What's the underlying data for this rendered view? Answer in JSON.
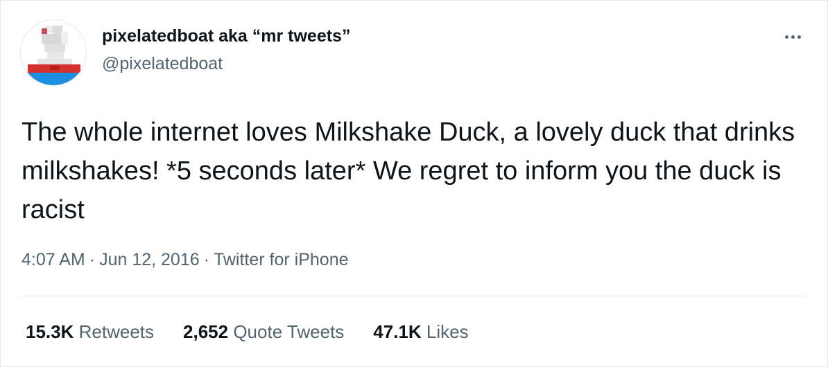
{
  "user": {
    "display_name": "pixelatedboat aka “mr tweets”",
    "handle": "@pixelatedboat"
  },
  "more_icon": "more-horizontal-icon",
  "tweet_text": "The whole internet loves Milkshake Duck, a lovely duck that drinks milkshakes! *5 seconds later* We regret to inform you the duck is racist",
  "meta": {
    "time": "4:07 AM",
    "separator": "·",
    "date": "Jun 12, 2016",
    "source": "Twitter for iPhone"
  },
  "stats": {
    "retweets_count": "15.3K",
    "retweets_label": "Retweets",
    "quotes_count": "2,652",
    "quotes_label": "Quote Tweets",
    "likes_count": "47.1K",
    "likes_label": "Likes"
  },
  "colors": {
    "text_primary": "#0f1419",
    "text_secondary": "#536471",
    "divider": "#e6e6e6",
    "avatar_red": "#d32f2f",
    "avatar_blue": "#1e8fe0"
  }
}
